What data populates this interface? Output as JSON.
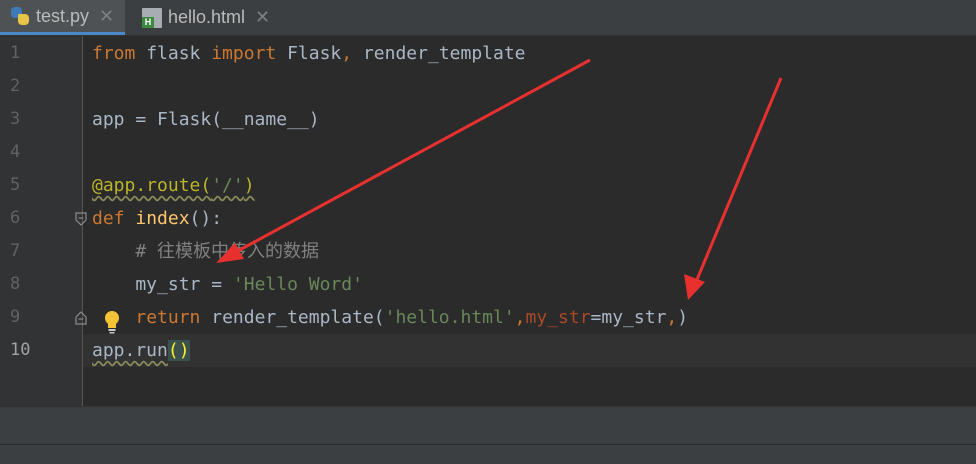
{
  "tabs": [
    {
      "label": "test.py",
      "icon": "python-file-icon",
      "active": true
    },
    {
      "label": "hello.html",
      "icon": "html-file-icon",
      "active": false
    }
  ],
  "editor": {
    "current_line": "10",
    "lines": [
      {
        "num": "1",
        "t": {
          "a": "from",
          "b": " flask ",
          "c": "import",
          "d": " Flask",
          "e": ",",
          "f": " render_template"
        }
      },
      {
        "num": "2"
      },
      {
        "num": "3",
        "t": {
          "a": "app = Flask(__name__)"
        }
      },
      {
        "num": "4"
      },
      {
        "num": "5",
        "t": {
          "a": "@app.route(",
          "b": "'/'",
          "c": ")"
        }
      },
      {
        "num": "6",
        "t": {
          "a": "def",
          "b": " ",
          "c": "index",
          "d": "():"
        }
      },
      {
        "num": "7",
        "t": {
          "a": "    # 往模板中传入的数据"
        }
      },
      {
        "num": "8",
        "t": {
          "a": "    my_str = ",
          "b": "'Hello Word'"
        }
      },
      {
        "num": "9",
        "t": {
          "a": "    ",
          "b": "return",
          "c": " render_template(",
          "d": "'hello.html'",
          "e": ",",
          "f": "my_str",
          "g": "=my_str",
          "h": ",",
          "i": ")"
        }
      },
      {
        "num": "10",
        "t": {
          "a": "app.run",
          "b": "()"
        }
      }
    ]
  },
  "colors": {
    "keyword": "#cc7832",
    "string": "#6a8759",
    "decorator": "#bbb529",
    "function": "#ffc66d",
    "comment": "#808080",
    "text": "#a9b7c6",
    "annotation_arrow": "#e8312f"
  }
}
